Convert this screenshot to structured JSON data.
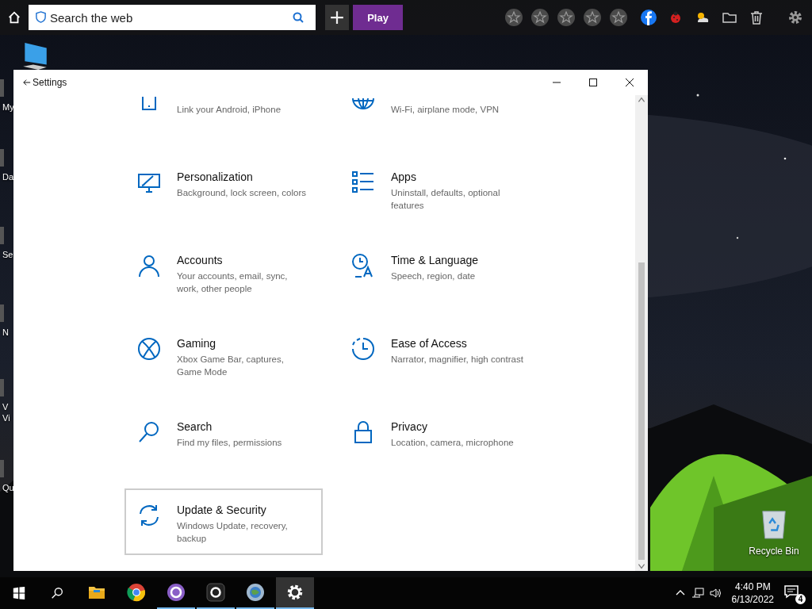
{
  "toolbar": {
    "search": {
      "placeholder": "Search the web"
    },
    "play_button": "Play"
  },
  "desktop_icons": [
    {
      "lines": [
        "My"
      ]
    },
    {
      "lines": [
        "Da"
      ]
    },
    {
      "lines": [
        "Se"
      ]
    },
    {
      "lines": [
        "N"
      ]
    },
    {
      "lines": [
        "V",
        "Vi"
      ]
    },
    {
      "lines": [
        "Qu"
      ]
    }
  ],
  "recycle_bin": {
    "label": "Recycle Bin"
  },
  "settings_window": {
    "title": "Settings",
    "items": [
      {
        "kind": "phone",
        "description": "Link your Android, iPhone",
        "focused": false
      },
      {
        "kind": "network",
        "description": "Wi-Fi, airplane mode, VPN",
        "focused": false
      },
      {
        "kind": "personalization",
        "title": "Personalization",
        "description": "Background, lock screen, colors",
        "focused": false
      },
      {
        "kind": "apps",
        "title": "Apps",
        "description": "Uninstall, defaults, optional features",
        "focused": false
      },
      {
        "kind": "accounts",
        "title": "Accounts",
        "description": "Your accounts, email, sync, work, other people",
        "focused": false
      },
      {
        "kind": "time",
        "title": "Time & Language",
        "description": "Speech, region, date",
        "focused": false
      },
      {
        "kind": "gaming",
        "title": "Gaming",
        "description": "Xbox Game Bar, captures, Game Mode",
        "focused": false
      },
      {
        "kind": "ease",
        "title": "Ease of Access",
        "description": "Narrator, magnifier, high contrast",
        "focused": false
      },
      {
        "kind": "search",
        "title": "Search",
        "description": "Find my files, permissions",
        "focused": false
      },
      {
        "kind": "privacy",
        "title": "Privacy",
        "description": "Location, camera, microphone",
        "focused": false
      },
      {
        "kind": "update",
        "title": "Update & Security",
        "description": "Windows Update, recovery, backup",
        "focused": true
      }
    ]
  },
  "taskbar": {
    "apps": [
      {
        "kind": "explorer",
        "running": false,
        "active": false
      },
      {
        "kind": "chrome",
        "running": false,
        "active": false
      },
      {
        "kind": "purple",
        "running": true,
        "active": false
      },
      {
        "kind": "dark",
        "running": true,
        "active": false
      },
      {
        "kind": "globe",
        "running": true,
        "active": false
      },
      {
        "kind": "settings",
        "running": true,
        "active": true
      }
    ],
    "time": "4:40 PM",
    "date": "6/13/2022",
    "notifications": "4"
  }
}
